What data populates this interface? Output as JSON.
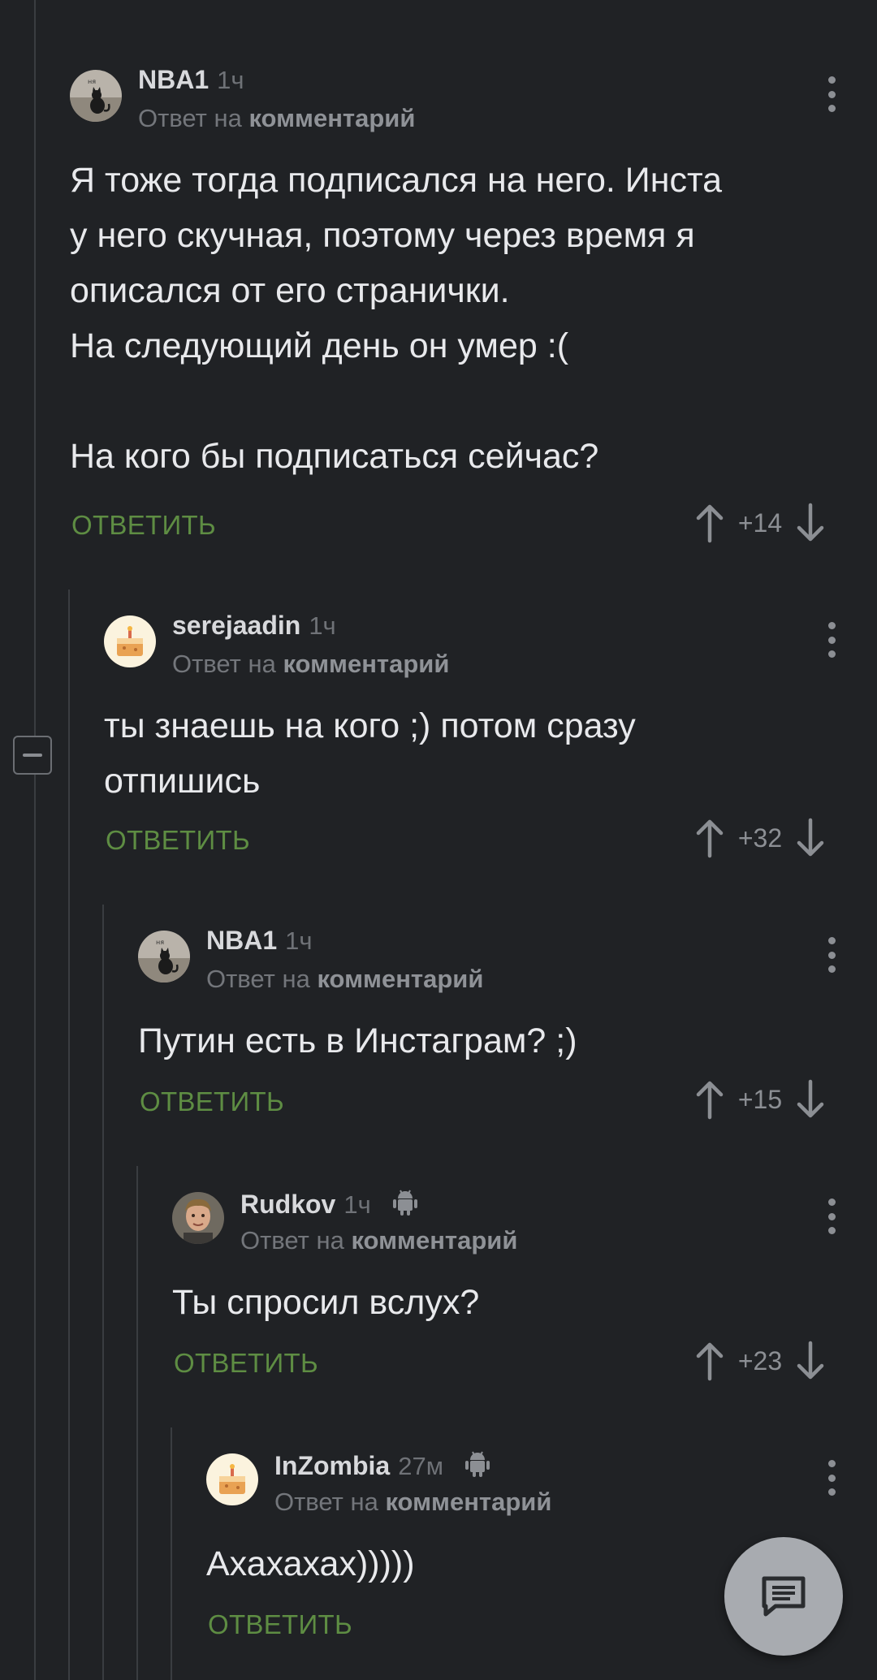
{
  "reply_to_prefix": "Ответ на",
  "reply_to_target": "комментарий",
  "reply_label": "ОТВЕТИТЬ",
  "colors": {
    "background": "#202225",
    "reply_accent": "#5e8d43",
    "muted": "#73767b"
  },
  "comments": [
    {
      "author": "NBA1",
      "time": "1ч",
      "avatar": "cat-avatar",
      "text": "Я тоже тогда подписался на него. Инста\nу него скучная, поэтому через время я\nописался от его странички.\nНа следующий день он умер :(\n\nНа кого бы подписаться сейчас?",
      "score": "+14"
    },
    {
      "author": "serejaadin",
      "time": "1ч",
      "avatar": "cake-avatar",
      "text": "ты знаешь на кого ;) потом сразу\nотпишись",
      "score": "+32"
    },
    {
      "author": "NBA1",
      "time": "1ч",
      "avatar": "cat-avatar",
      "text": "Путин есть в Инстаграм? ;)",
      "score": "+15"
    },
    {
      "author": "Rudkov",
      "time": "1ч",
      "avatar": "photo-avatar",
      "platform": "android-icon",
      "text": "Ты спросил вслух?",
      "score": "+23"
    },
    {
      "author": "InZombia",
      "time": "27м",
      "avatar": "cake-avatar",
      "platform": "android-icon",
      "text": "Ахахахах)))))"
    }
  ]
}
